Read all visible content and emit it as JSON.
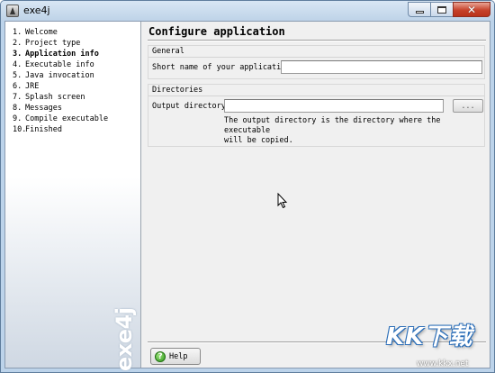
{
  "window": {
    "title": "exe4j"
  },
  "sidebar": {
    "brand": "exe4j",
    "steps": [
      {
        "num": "1.",
        "label": "Welcome"
      },
      {
        "num": "2.",
        "label": "Project type"
      },
      {
        "num": "3.",
        "label": "Application info"
      },
      {
        "num": "4.",
        "label": "Executable info"
      },
      {
        "num": "5.",
        "label": "Java invocation"
      },
      {
        "num": "6.",
        "label": "JRE"
      },
      {
        "num": "7.",
        "label": "Splash screen"
      },
      {
        "num": "8.",
        "label": "Messages"
      },
      {
        "num": "9.",
        "label": "Compile executable"
      },
      {
        "num": "10.",
        "label": "Finished"
      }
    ],
    "current_step": "Application info"
  },
  "main": {
    "title": "Configure application",
    "general": {
      "heading": "General",
      "short_name_label": "Short name of your application:",
      "short_name_value": ""
    },
    "directories": {
      "heading": "Directories",
      "output_label": "Output directory:",
      "output_value": "",
      "browse_label": "...",
      "help_text": "The output directory is the directory where the executable\nwill be copied."
    },
    "help_button": "Help"
  },
  "watermark": {
    "logo": "KK下载",
    "url": "www.kkx.net"
  },
  "colors": {
    "accent_close": "#c7422b",
    "frame": "#bcd3ea"
  }
}
